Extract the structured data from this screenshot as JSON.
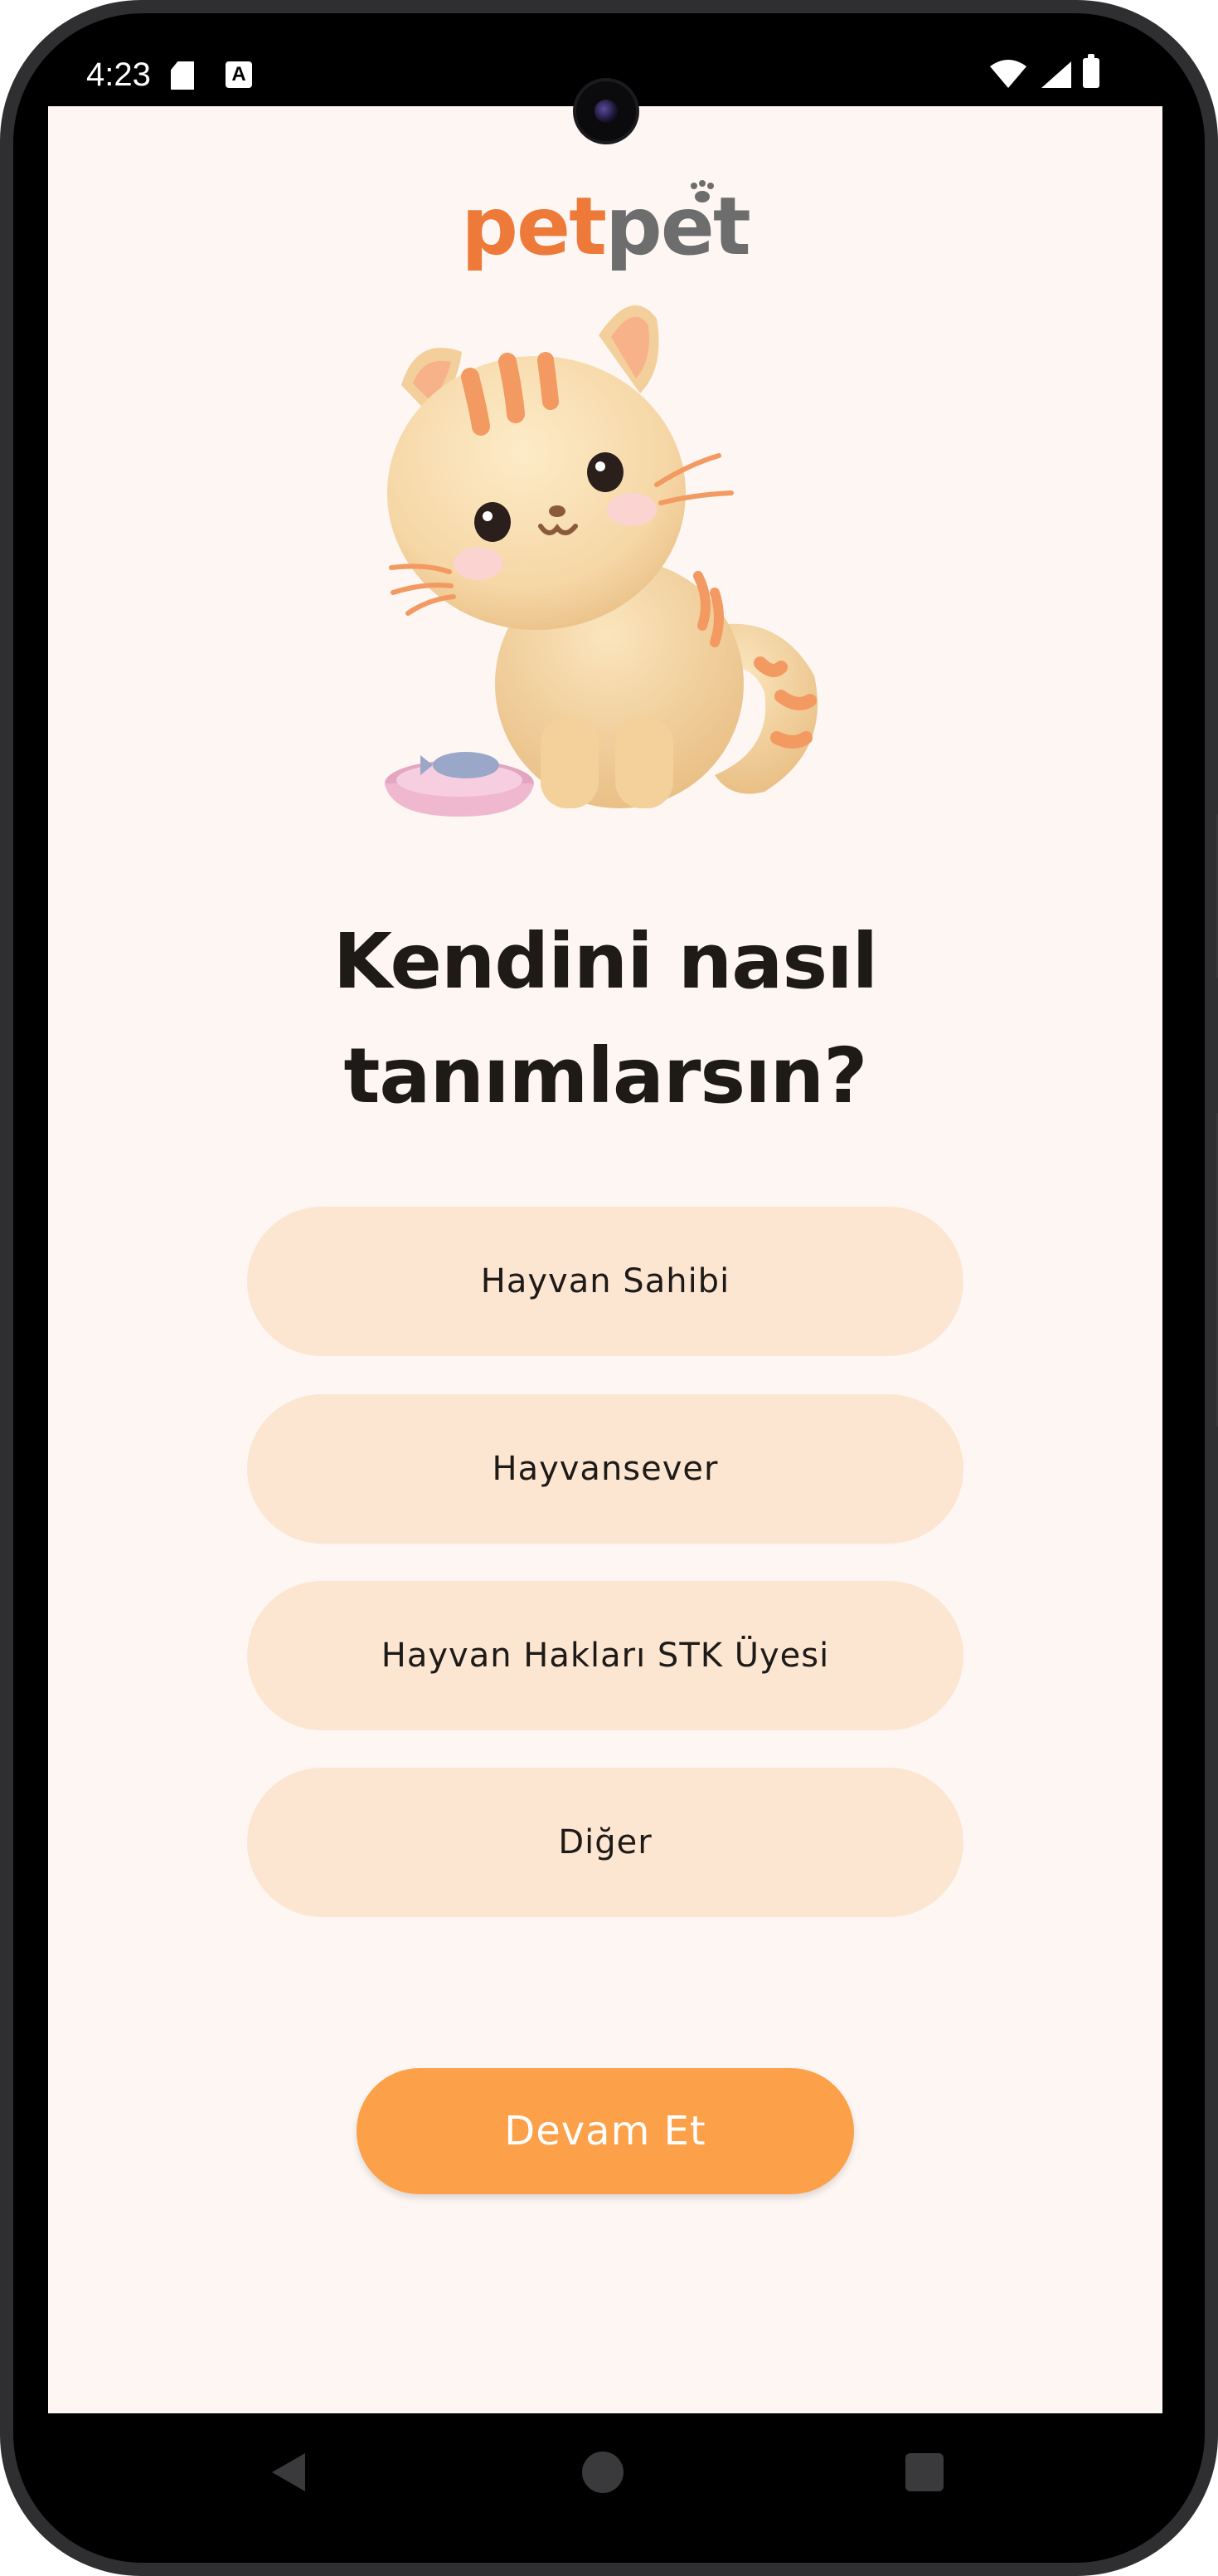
{
  "status_bar": {
    "time": "4:23",
    "icons": [
      "sd-card-icon",
      "text-a-icon",
      "wifi-icon",
      "cell-signal-icon",
      "battery-icon"
    ]
  },
  "brand": {
    "logo_part1": "pet",
    "logo_part2": "pet",
    "color_primary": "#ee7a3a",
    "color_secondary": "#6d6d6d"
  },
  "illustration": {
    "icon": "kitten-with-food-bowl-illustration"
  },
  "question": {
    "line1": "Kendini nasıl",
    "line2": "tanımlarsın?"
  },
  "options": [
    {
      "label": "Hayvan Sahibi"
    },
    {
      "label": "Hayvansever"
    },
    {
      "label": "Hayvan Hakları STK Üyesi"
    },
    {
      "label": "Diğer"
    }
  ],
  "primary_action": {
    "label": "Devam Et",
    "color": "#fca14a"
  },
  "theme": {
    "background": "#fdf6f3",
    "option_background": "#fce6d2",
    "text": "#1e1a17"
  },
  "navigation_bar": {
    "icons": [
      "back-icon",
      "home-icon",
      "recents-icon"
    ]
  }
}
